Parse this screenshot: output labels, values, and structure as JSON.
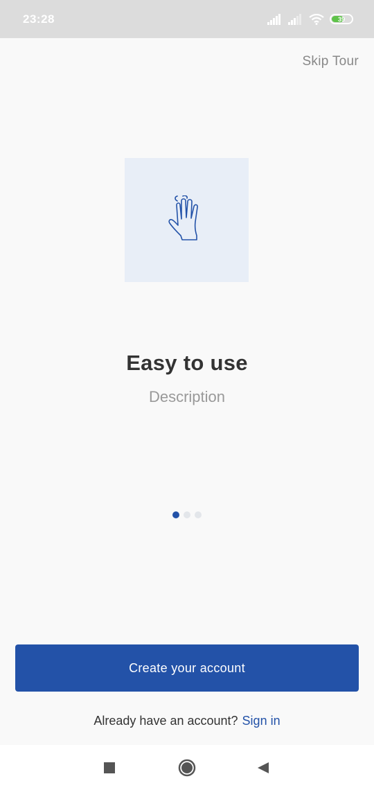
{
  "status_bar": {
    "time": "23:28",
    "battery_level": "39",
    "icons": [
      "signal-icon",
      "signal-icon-secondary",
      "wifi-icon",
      "battery-icon"
    ]
  },
  "header": {
    "skip_label": "Skip Tour"
  },
  "slide": {
    "illustration_icon": "hand-wave-icon",
    "title": "Easy to use",
    "description": "Description",
    "page_index": 1,
    "page_count": 3
  },
  "actions": {
    "create_account_label": "Create your account",
    "have_account_text": "Already have an account?",
    "sign_in_label": "Sign in"
  },
  "nav_bar": {
    "icons": [
      "recents-icon",
      "home-icon",
      "back-icon"
    ]
  },
  "colors": {
    "primary": "#2352a8",
    "illustration_bg": "#e8eef7",
    "battery": "#5fc34a"
  }
}
